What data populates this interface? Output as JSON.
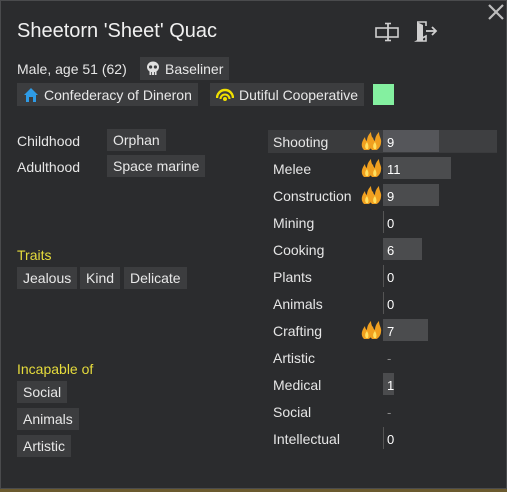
{
  "header": {
    "name": "Sheetorn 'Sheet' Quac",
    "subline": "Male, age 51 (62)",
    "xenotype": "Baseliner",
    "faction": "Confederacy of Dineron",
    "ideoligion": "Dutiful Cooperative",
    "favorite_color": "#84f0a0"
  },
  "backstory": {
    "childhood_label": "Childhood",
    "childhood_value": "Orphan",
    "adulthood_label": "Adulthood",
    "adulthood_value": "Space marine"
  },
  "traits": {
    "title": "Traits",
    "items": [
      "Jealous",
      "Kind",
      "Delicate"
    ]
  },
  "incapable": {
    "title": "Incapable of",
    "items": [
      "Social",
      "Animals",
      "Artistic"
    ]
  },
  "skills": [
    {
      "name": "Shooting",
      "level": "9",
      "level_num": 9,
      "passion": "major",
      "highlight": true
    },
    {
      "name": "Melee",
      "level": "11",
      "level_num": 11,
      "passion": "major",
      "highlight": false
    },
    {
      "name": "Construction",
      "level": "9",
      "level_num": 9,
      "passion": "major",
      "highlight": false
    },
    {
      "name": "Mining",
      "level": "0",
      "level_num": 0,
      "passion": "none",
      "highlight": false
    },
    {
      "name": "Cooking",
      "level": "6",
      "level_num": 6,
      "passion": "none",
      "highlight": false
    },
    {
      "name": "Plants",
      "level": "0",
      "level_num": 0,
      "passion": "none",
      "highlight": false
    },
    {
      "name": "Animals",
      "level": "0",
      "level_num": 0,
      "passion": "none",
      "highlight": false
    },
    {
      "name": "Crafting",
      "level": "7",
      "level_num": 7,
      "passion": "major",
      "highlight": false
    },
    {
      "name": "Artistic",
      "level": "-",
      "level_num": 0,
      "passion": "none",
      "highlight": false
    },
    {
      "name": "Medical",
      "level": "1",
      "level_num": 1,
      "passion": "none",
      "highlight": false
    },
    {
      "name": "Social",
      "level": "-",
      "level_num": 0,
      "passion": "none",
      "highlight": false
    },
    {
      "name": "Intellectual",
      "level": "0",
      "level_num": 0,
      "passion": "none",
      "highlight": false
    }
  ],
  "skill_max": 20
}
